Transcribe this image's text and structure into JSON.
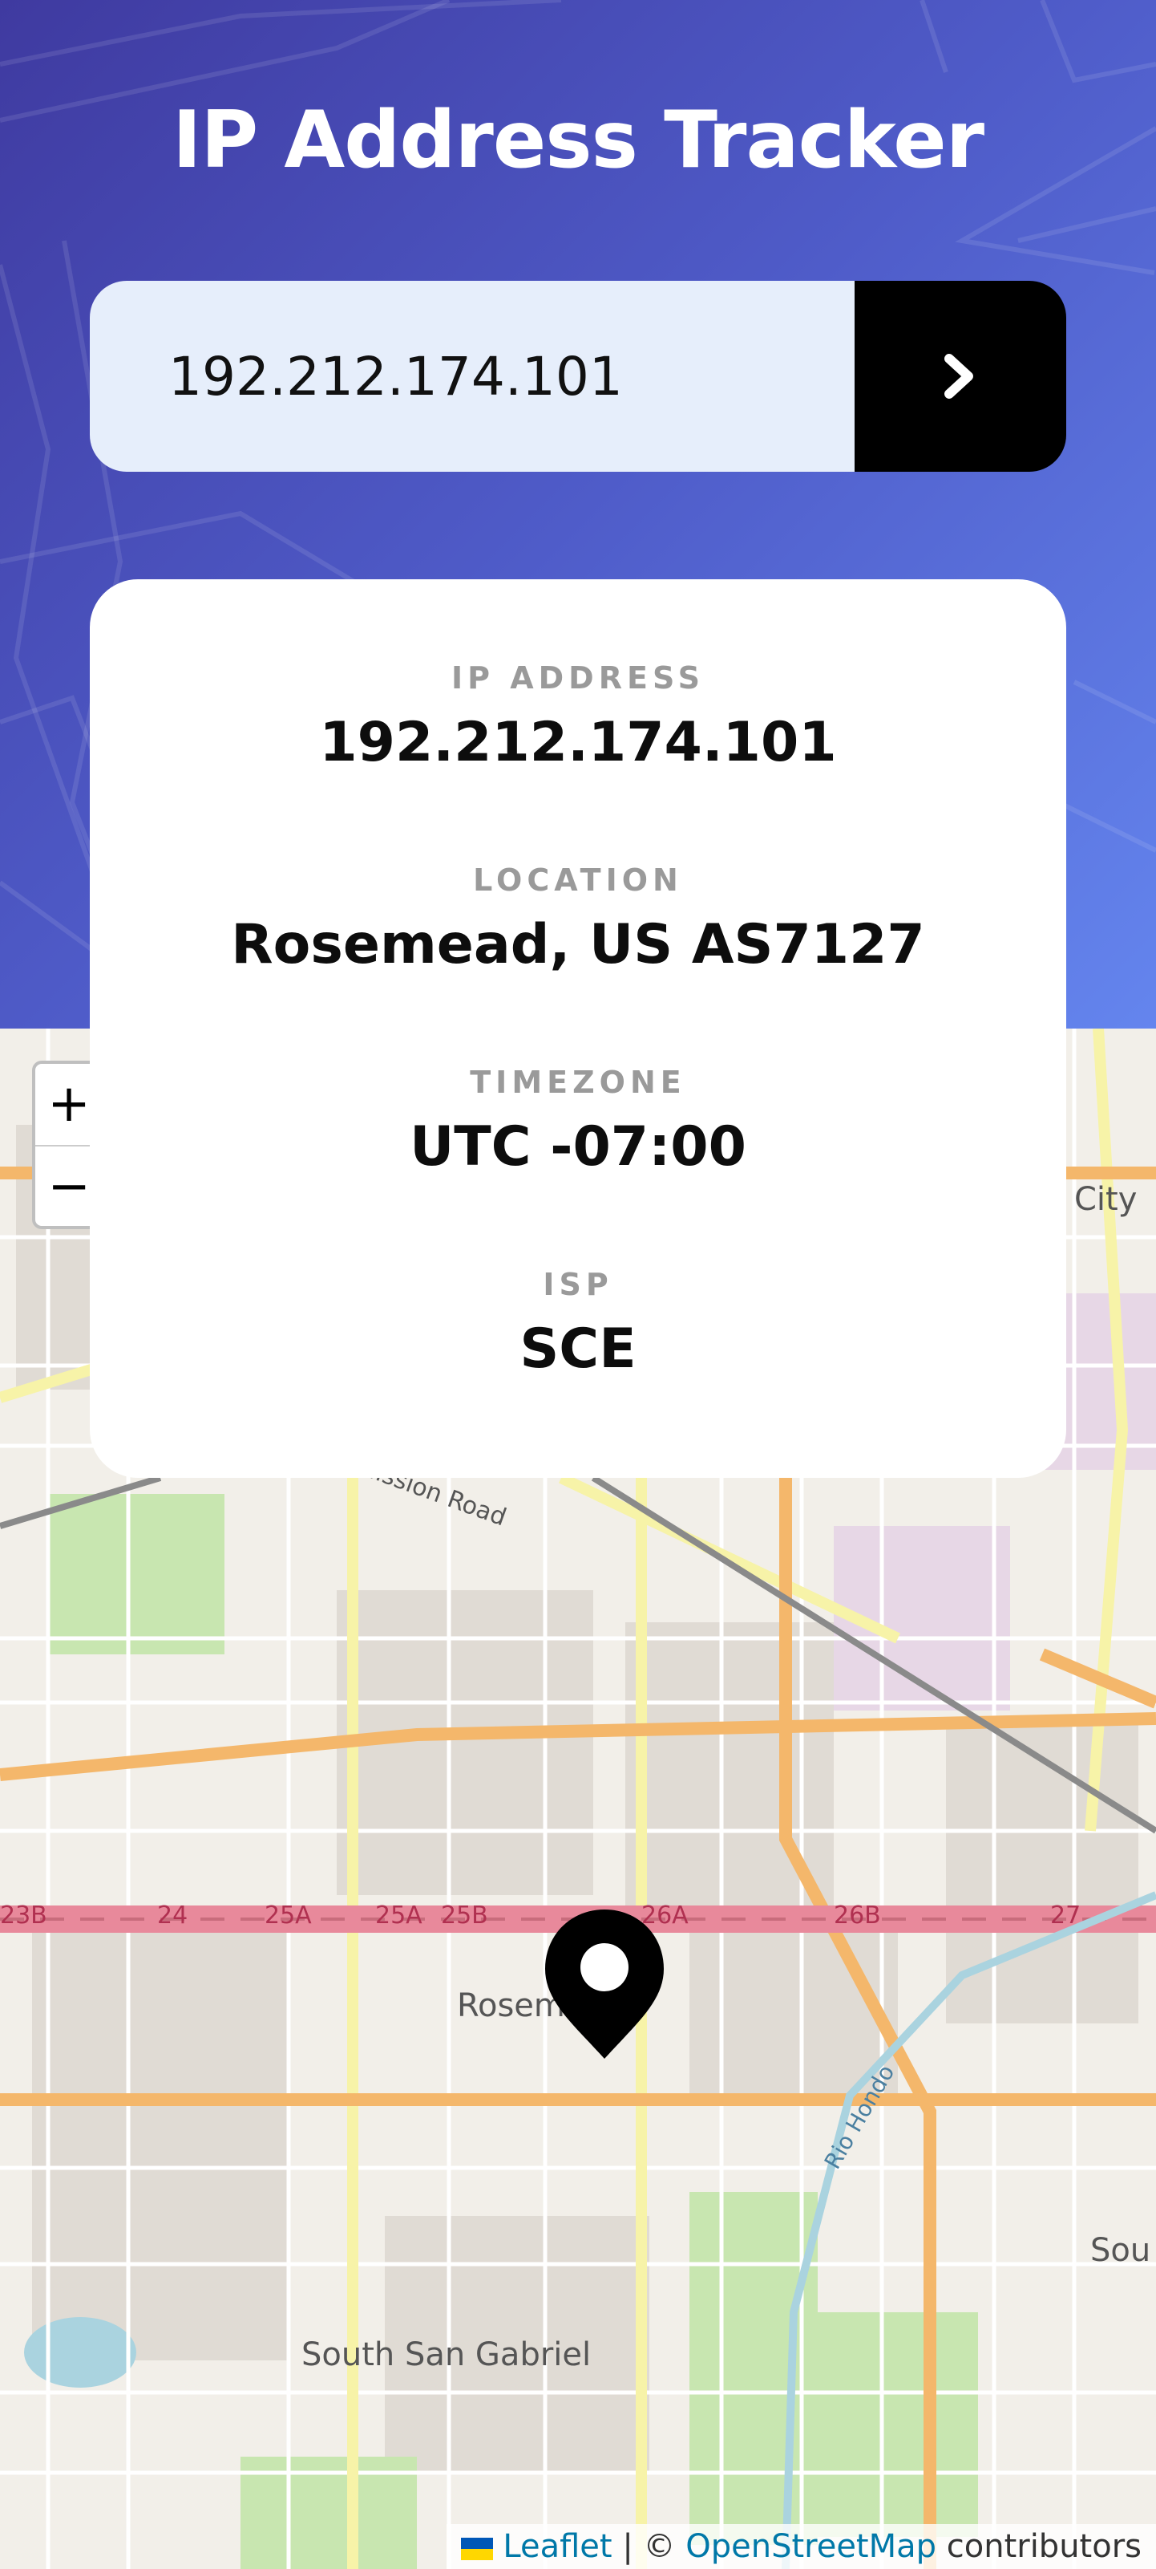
{
  "header": {
    "title": "IP Address Tracker"
  },
  "search": {
    "value": "192.212.174.101",
    "submit_icon": "chevron-right-icon"
  },
  "info": {
    "ip_label": "IP ADDRESS",
    "ip_value": "192.212.174.101",
    "location_label": "LOCATION",
    "location_value": "Rosemead, US AS7127",
    "timezone_label": "TIMEZONE",
    "timezone_value": "UTC -07:00",
    "isp_label": "ISP",
    "isp_value": "SCE"
  },
  "map": {
    "zoom_in": "+",
    "zoom_out": "−",
    "marker_icon": "location-pin-icon",
    "labels": {
      "city_right": "City",
      "mission_road": "Mission Road",
      "rosemead": "Rosemead",
      "south_san_gabriel": "South San Gabriel",
      "south_right": "Sou",
      "rio_hondo": "Rio Hondo",
      "exit_23b": "23B",
      "exit_24": "24",
      "exit_25a": "25A",
      "exit_25a_2": "25A",
      "exit_25b": "25B",
      "exit_26a": "26A",
      "exit_26b": "26B",
      "exit_27": "27"
    },
    "attribution": {
      "leaflet": "Leaflet",
      "separator": " | © ",
      "osm": "OpenStreetMap",
      "contributors": " contributors"
    }
  },
  "colors": {
    "header_gradient_start": "#3f3aa0",
    "header_gradient_end": "#6485ee",
    "button_bg": "#000000",
    "input_bg": "#e6eefb"
  }
}
